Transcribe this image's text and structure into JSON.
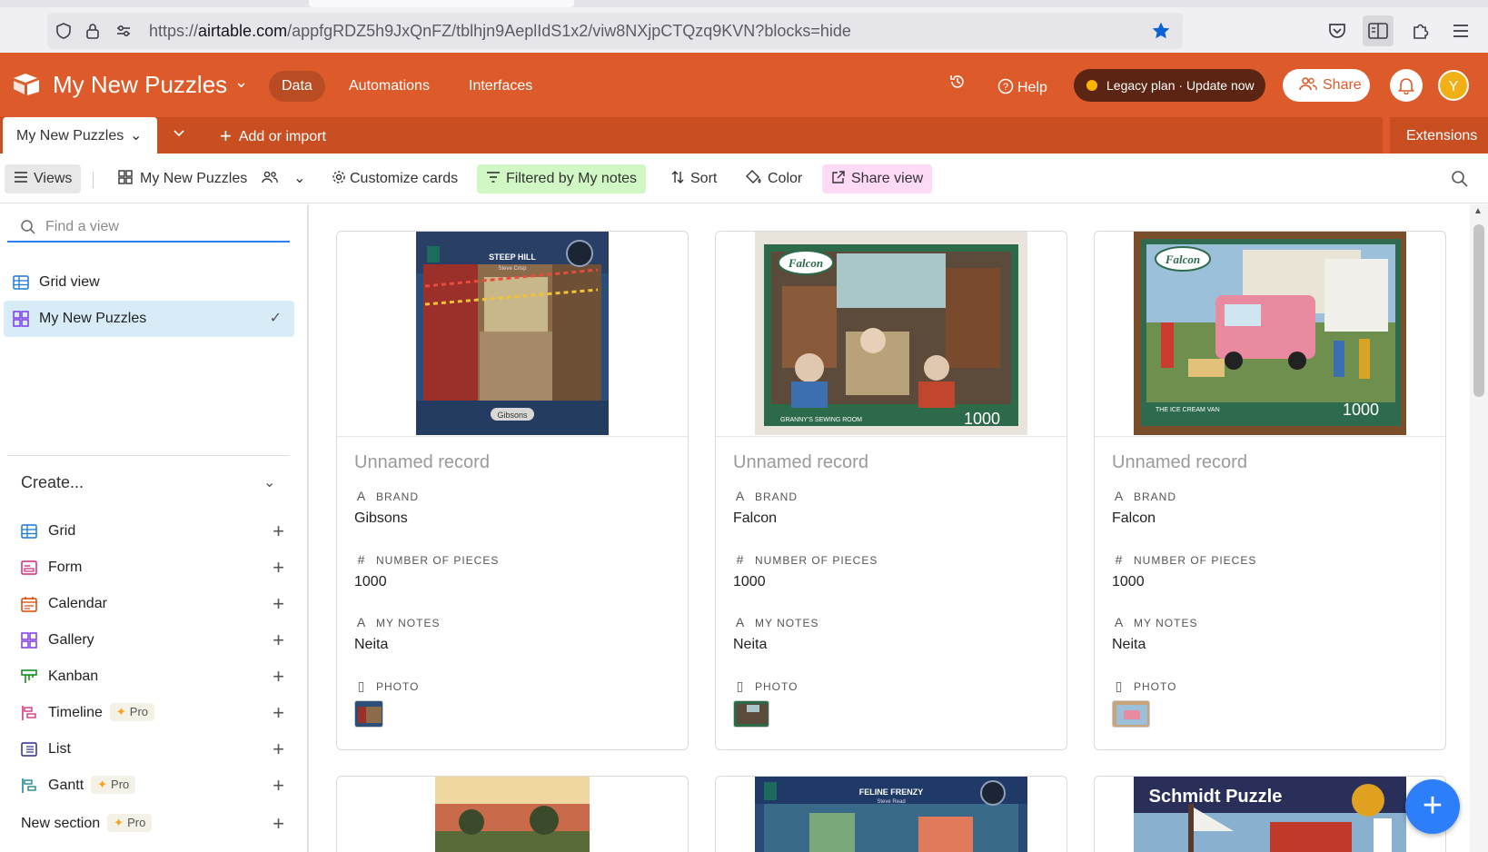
{
  "browser": {
    "url_prefix": "https://",
    "url_host": "airtable.com",
    "url_path": "/appfgRDZ5h9JxQnFZ/tblhjn9AeplIdS1x2/viw8NXjpCTQzq9KVN?blocks=hide"
  },
  "header": {
    "base_name": "My New Puzzles",
    "nav": [
      "Data",
      "Automations",
      "Interfaces"
    ],
    "help": "Help",
    "legacy": "Legacy plan · Update now",
    "share": "Share",
    "avatar": "Y",
    "brand_color": "#dd5b2a"
  },
  "tabs": {
    "active": "My New Puzzles",
    "add_import": "Add or import",
    "extensions": "Extensions"
  },
  "toolbar": {
    "views": "Views",
    "view_name": "My New Puzzles",
    "customize": "Customize cards",
    "filter": "Filtered by My notes",
    "sort": "Sort",
    "color": "Color",
    "share_view": "Share view"
  },
  "sidebar": {
    "find_placeholder": "Find a view",
    "views": [
      "Grid view",
      "My New Puzzles"
    ],
    "create_label": "Create...",
    "create_items": [
      "Grid",
      "Form",
      "Calendar",
      "Gallery",
      "Kanban",
      "Timeline",
      "List",
      "Gantt",
      "New section"
    ],
    "pro": "Pro"
  },
  "cards": [
    {
      "title": "Unnamed record",
      "brand_label": "BRAND",
      "brand": "Gibsons",
      "pieces_label": "NUMBER OF PIECES",
      "pieces": "1000",
      "notes_label": "MY NOTES",
      "notes": "Neita",
      "photo_label": "PHOTO",
      "cover_title": "STEEP HILL",
      "cover_sub": "Steve Crisp",
      "cover_brand": "Gibsons"
    },
    {
      "title": "Unnamed record",
      "brand_label": "BRAND",
      "brand": "Falcon",
      "pieces_label": "NUMBER OF PIECES",
      "pieces": "1000",
      "notes_label": "MY NOTES",
      "notes": "Neita",
      "photo_label": "PHOTO",
      "cover_title": "Falcon",
      "cover_sub": "GRANNY'S SEWING ROOM",
      "cover_count": "1000"
    },
    {
      "title": "Unnamed record",
      "brand_label": "BRAND",
      "brand": "Falcon",
      "pieces_label": "NUMBER OF PIECES",
      "pieces": "1000",
      "notes_label": "MY NOTES",
      "notes": "Neita",
      "photo_label": "PHOTO",
      "cover_title": "Falcon",
      "cover_sub": "THE ICE CREAM VAN",
      "cover_count": "1000"
    }
  ],
  "row2": [
    {
      "cover_title": ""
    },
    {
      "cover_title": "FELINE FRENZY",
      "cover_sub": "Steve Read"
    },
    {
      "cover_title": "Schmidt Puzzle"
    }
  ]
}
